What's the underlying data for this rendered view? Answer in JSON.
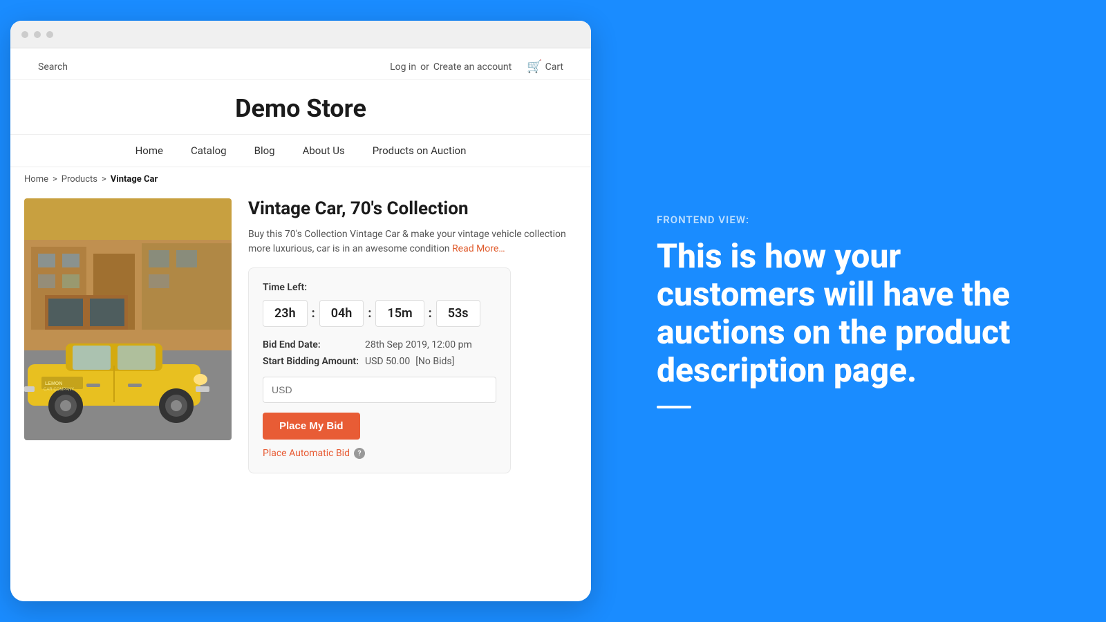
{
  "left": {
    "browser": {
      "dots": [
        "dot1",
        "dot2",
        "dot3"
      ]
    },
    "header": {
      "search_label": "Search",
      "login_label": "Log in",
      "or_label": "or",
      "create_account_label": "Create an account",
      "cart_label": "Cart"
    },
    "store_title": "Demo Store",
    "nav": {
      "items": [
        {
          "label": "Home",
          "id": "home"
        },
        {
          "label": "Catalog",
          "id": "catalog"
        },
        {
          "label": "Blog",
          "id": "blog"
        },
        {
          "label": "About Us",
          "id": "about"
        },
        {
          "label": "Products on Auction",
          "id": "auction"
        }
      ]
    },
    "breadcrumb": {
      "home": "Home",
      "separator1": ">",
      "products": "Products",
      "separator2": ">",
      "current": "Vintage Car"
    },
    "product": {
      "title": "Vintage Car, 70's Collection",
      "description": "Buy this 70's Collection Vintage Car & make your vintage vehicle collection more luxurious, car is in an awesome condition",
      "read_more": "Read More…",
      "auction": {
        "time_left_label": "Time Left:",
        "hours": "23h",
        "minutes": "04h",
        "minutes2": "15m",
        "seconds": "53s",
        "sep1": ":",
        "sep2": ":",
        "sep3": ":",
        "bid_end_label": "Bid End Date:",
        "bid_end_value": "28th Sep 2019, 12:00 pm",
        "start_bid_label": "Start Bidding Amount:",
        "start_bid_value": "USD 50.00",
        "no_bids": "[No Bids]",
        "input_placeholder": "USD",
        "place_bid_label": "Place My Bid",
        "auto_bid_label": "Place Automatic Bid",
        "help_icon": "?"
      }
    }
  },
  "right": {
    "label": "FRONTEND VIEW:",
    "heading": "This is how your customers will have the auctions on the product description page."
  }
}
